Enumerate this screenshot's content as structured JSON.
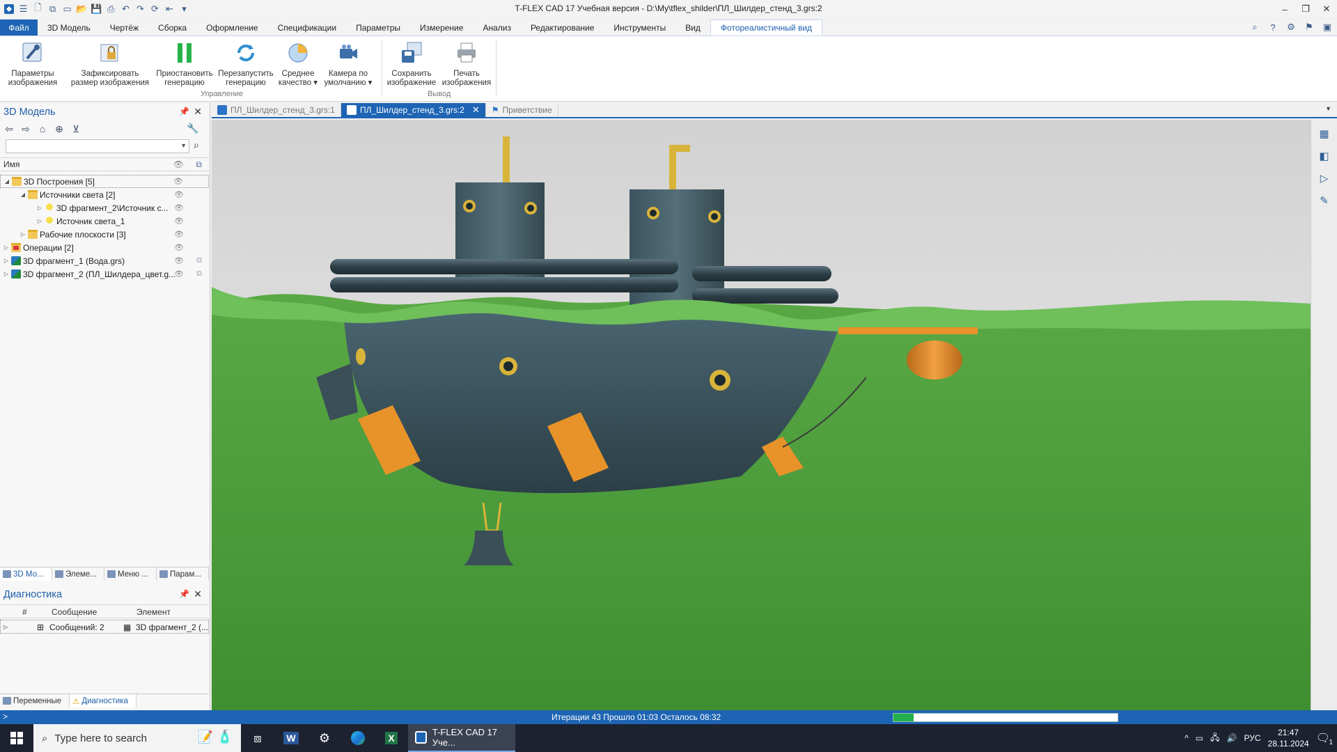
{
  "window": {
    "title": "T-FLEX CAD 17 Учебная версия - D:\\My\\tflex_shilder\\ПЛ_Шилдер_стенд_3.grs:2"
  },
  "menu": {
    "tabs": [
      {
        "label": "Файл"
      },
      {
        "label": "3D Модель"
      },
      {
        "label": "Чертёж"
      },
      {
        "label": "Сборка"
      },
      {
        "label": "Оформление"
      },
      {
        "label": "Спецификации"
      },
      {
        "label": "Параметры"
      },
      {
        "label": "Измерение"
      },
      {
        "label": "Анализ"
      },
      {
        "label": "Редактирование"
      },
      {
        "label": "Инструменты"
      },
      {
        "label": "Вид"
      },
      {
        "label": "Фотореалистичный вид"
      }
    ]
  },
  "ribbon": {
    "buttons": [
      {
        "line1": "Параметры",
        "line2": "изображения"
      },
      {
        "line1": "Зафиксировать",
        "line2": "размер изображения"
      },
      {
        "line1": "Приостановить",
        "line2": "генерацию"
      },
      {
        "line1": "Перезапустить",
        "line2": "генерацию"
      },
      {
        "line1": "Среднее",
        "line2": "качество ▾"
      },
      {
        "line1": "Камера по",
        "line2": "умолчанию ▾"
      },
      {
        "line1": "Сохранить",
        "line2": "изображение"
      },
      {
        "line1": "Печать",
        "line2": "изображения"
      }
    ],
    "groups": {
      "control": "Управление",
      "output": "Вывод"
    }
  },
  "model_panel": {
    "title": "3D Модель",
    "column_name": "Имя",
    "tree": [
      {
        "label": "3D Построения [5]"
      },
      {
        "label": "Источники света [2]"
      },
      {
        "label": "3D фрагмент_2\\Источник с..."
      },
      {
        "label": "Источник света_1"
      },
      {
        "label": "Рабочие плоскости [3]"
      },
      {
        "label": "Операции [2]"
      },
      {
        "label": "3D фрагмент_1 (Вода.grs)"
      },
      {
        "label": "3D фрагмент_2 (ПЛ_Шилдера_цвет.g..."
      }
    ],
    "bottom_tabs": [
      {
        "label": "3D Мо..."
      },
      {
        "label": "Элеме..."
      },
      {
        "label": "Меню ..."
      },
      {
        "label": "Парам..."
      }
    ]
  },
  "diagnostics": {
    "title": "Диагностика",
    "columns": {
      "num": "#",
      "message": "Сообщение",
      "element": "Элемент"
    },
    "row": {
      "message": "Сообщений: 2",
      "element": "3D фрагмент_2 (..."
    },
    "bottom_tabs": [
      {
        "label": "Переменные"
      },
      {
        "label": "Диагностика"
      }
    ]
  },
  "doc_tabs": [
    {
      "label": "ПЛ_Шилдер_стенд_3.grs:1"
    },
    {
      "label": "ПЛ_Шилдер_стенд_3.grs:2"
    },
    {
      "label": "Приветствие"
    }
  ],
  "status": {
    "prompt": ">",
    "message": "Итерации 43 Прошло 01:03 Осталось 08:32",
    "progress": 0.09
  },
  "taskbar": {
    "search_placeholder": "Type here to search",
    "app_label": "T-FLEX CAD 17 Уче...",
    "lang": "РУС",
    "time": "21:47",
    "date": "28.11.2024",
    "notifications": "1"
  },
  "colors": {
    "accent": "#1e64b4",
    "grass": "#4a9a3a",
    "hull": "#3d5560",
    "wood": "#e8922a",
    "brass": "#d9b43a"
  }
}
